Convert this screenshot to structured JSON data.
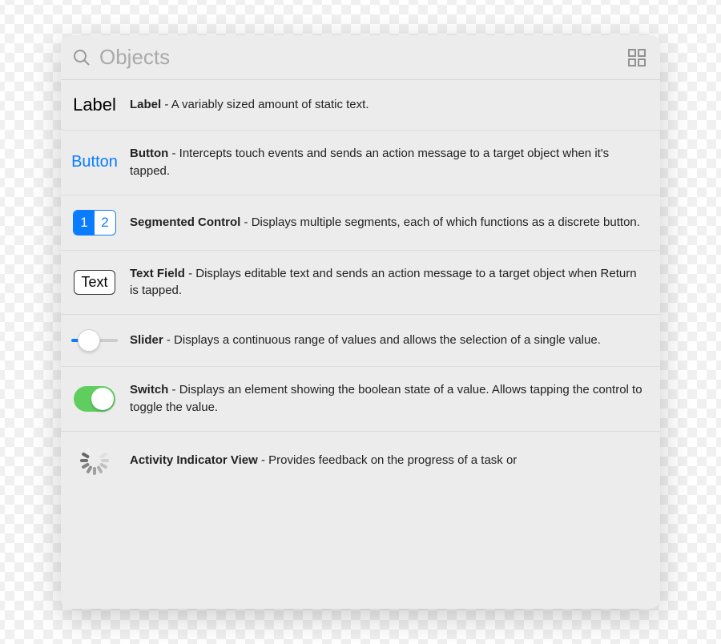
{
  "header": {
    "search_placeholder": "Objects"
  },
  "items": [
    {
      "thumb_kind": "label",
      "thumb_text": "Label",
      "title": "Label",
      "description": "A variably sized amount of static text."
    },
    {
      "thumb_kind": "button",
      "thumb_text": "Button",
      "title": "Button",
      "description": "Intercepts touch events and sends an action message to a target object when it's tapped."
    },
    {
      "thumb_kind": "segmented",
      "seg_on": "1",
      "seg_off": "2",
      "title": "Segmented Control",
      "description": "Displays multiple segments, each of which functions as a discrete button."
    },
    {
      "thumb_kind": "textfield",
      "thumb_text": "Text",
      "title": "Text Field",
      "description": "Displays editable text and sends an action message to a target object when Return is tapped."
    },
    {
      "thumb_kind": "slider",
      "title": "Slider",
      "description": "Displays a continuous range of values and allows the selection of a single value."
    },
    {
      "thumb_kind": "switch",
      "title": "Switch",
      "description": "Displays an element showing the boolean state of a value. Allows tapping the control to toggle the value."
    },
    {
      "thumb_kind": "spinner",
      "title": "Activity Indicator View",
      "description": "Provides feedback on the progress of a task or"
    }
  ],
  "separator": " - "
}
